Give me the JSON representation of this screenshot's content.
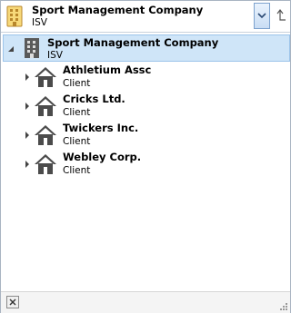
{
  "selector": {
    "title": "Sport Management Company",
    "subtitle": "ISV",
    "icon": "building-icon",
    "dropdown_icon": "chevron-down-icon",
    "up_icon": "level-up-icon"
  },
  "tree": {
    "root": {
      "label": "Sport Management Company",
      "type": "ISV",
      "icon": "office-building-icon",
      "expanded": true
    },
    "children": [
      {
        "label": "Athletium Assc",
        "type": "Client",
        "icon": "house-icon"
      },
      {
        "label": "Cricks Ltd.",
        "type": "Client",
        "icon": "house-icon"
      },
      {
        "label": "Twickers Inc.",
        "type": "Client",
        "icon": "house-icon"
      },
      {
        "label": "Webley Corp.",
        "type": "Client",
        "icon": "house-icon"
      }
    ]
  },
  "footer": {
    "close_icon": "close-icon",
    "grip_icon": "resize-grip-icon"
  },
  "colors": {
    "selection_bg": "#cfe5f8",
    "selection_border": "#9dc4ea",
    "accent_gold": "#e6b94a",
    "icon_gray": "#4b4b4b"
  }
}
